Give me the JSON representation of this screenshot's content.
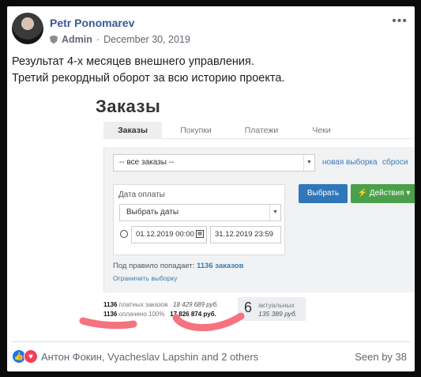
{
  "post": {
    "author": "Petr Ponomarev",
    "role": "Admin",
    "date": "December 30, 2019",
    "more": "•••",
    "text_line1": "Результат 4-х месяцев внешнего управления.",
    "text_line2": "Третий рекордный оборот за всю историю проекта."
  },
  "shot": {
    "title": "Заказы",
    "tabs": [
      "Заказы",
      "Покупки",
      "Платежи",
      "Чеки"
    ],
    "filter_select": "-- все заказы --",
    "new_selection": "новая выборка",
    "reset": "сброси",
    "date_label": "Дата оплаты",
    "date_select": "Выбрать даты",
    "date_from": "01.12.2019 00:00",
    "date_to": "31.12.2019 23:59",
    "choose_button": "Выбрать",
    "actions_button": "⚡ Действия ▾",
    "rule_prefix": "Под правило попадает:",
    "rule_count": "1136 заказов",
    "limit_link": "Ограничить выборку",
    "stats": {
      "paid_count": "1136",
      "paid_label": "платных заказов",
      "paid_sum": "18 429 689 руб.",
      "done_count": "1136",
      "done_label": "оплачено 100%",
      "done_sum": "17 826 874 руб.",
      "actual_num": "6",
      "actual_label": "актуальных",
      "actual_sum": "135 389 руб."
    }
  },
  "footer": {
    "reactions": "Антон Фокин, Vyacheslav Lapshin and 2 others",
    "seen": "Seen by 38"
  },
  "colors": {
    "link": "#385898",
    "primary": "#2f77b8",
    "success": "#4aa04a",
    "scribble": "#f7727f"
  }
}
